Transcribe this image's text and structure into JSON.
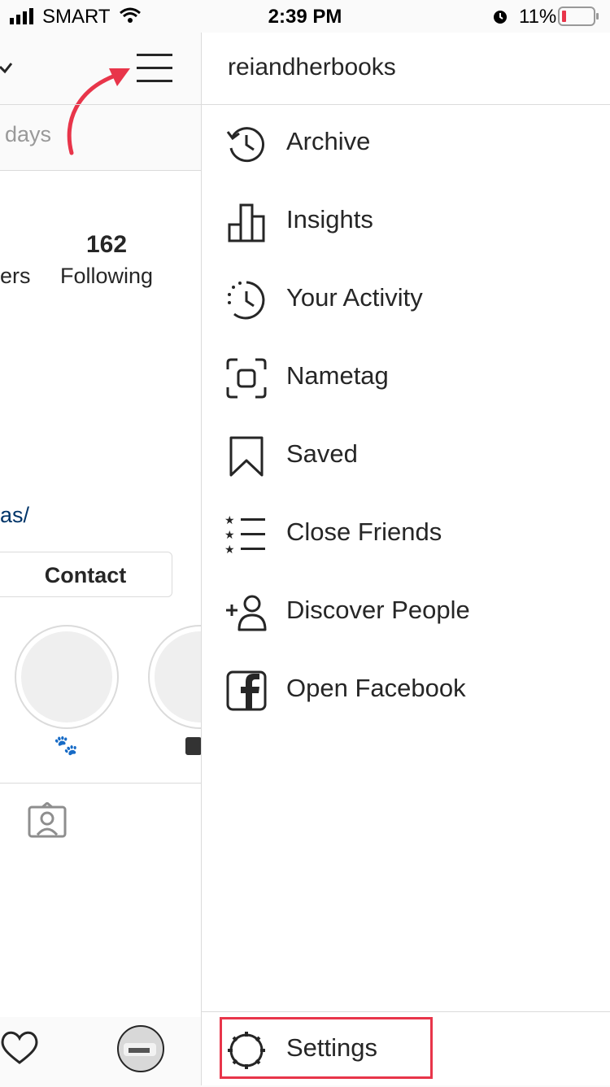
{
  "status_bar": {
    "carrier": "SMART",
    "time": "2:39 PM",
    "battery": "11%"
  },
  "profile": {
    "days_text": "days",
    "following_count": "162",
    "following_label": "Following",
    "followers_label_fragment": "ers",
    "link_fragment": "as/",
    "contact_button": "Contact",
    "highlight_icon": "paw-prints-icon"
  },
  "drawer": {
    "username": "reiandherbooks",
    "items": [
      {
        "label": "Archive",
        "icon": "archive-icon"
      },
      {
        "label": "Insights",
        "icon": "insights-icon"
      },
      {
        "label": "Your Activity",
        "icon": "activity-icon"
      },
      {
        "label": "Nametag",
        "icon": "nametag-icon"
      },
      {
        "label": "Saved",
        "icon": "bookmark-icon"
      },
      {
        "label": "Close Friends",
        "icon": "close-friends-icon"
      },
      {
        "label": "Discover People",
        "icon": "add-person-icon"
      },
      {
        "label": "Open Facebook",
        "icon": "facebook-icon"
      }
    ],
    "settings_label": "Settings"
  },
  "colors": {
    "highlight_red": "#e8354a",
    "link_blue": "#003569"
  }
}
